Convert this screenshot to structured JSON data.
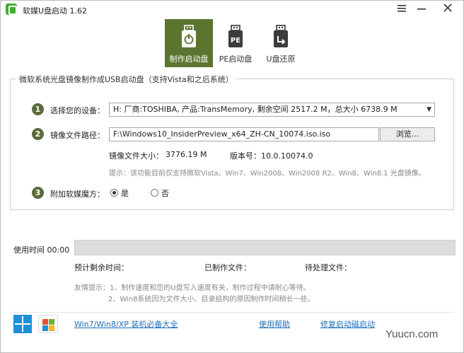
{
  "titlebar": {
    "title": "软媒U盘启动 1.62",
    "menu_icon": "menu-icon",
    "minimize_icon": "minimize-icon",
    "close_icon": "close-icon"
  },
  "tools": [
    {
      "label": "制作启动盘",
      "icon": "usb-power-icon",
      "active": true
    },
    {
      "label": "PE启动盘",
      "icon": "pe-usb-icon",
      "active": false
    },
    {
      "label": "U盘还原",
      "icon": "usb-restore-icon",
      "active": false
    }
  ],
  "group": {
    "title": "微软系统光盘镜像制作成USB启动盘（支持Vista和之后系统）",
    "steps": [
      {
        "number": "1",
        "label": "选择您的设备："
      },
      {
        "number": "2",
        "label": "镜像文件路径："
      },
      {
        "number": "3",
        "label": "附加软媒魔方："
      }
    ],
    "device_value": "H: 厂商:TOSHIBA, 产品:TransMemory,  剩余空间 2517.2 M，总大小 6738.9 M",
    "path_value": "F:\\Windows10_InsiderPreview_x64_ZH-CN_10074.iso.iso",
    "browse_label": "浏览...",
    "image_size_label": "镜像文件大小：",
    "image_size_value": "3776.19 M",
    "version_label": "版本号：10.0.10074.0",
    "hint": "提示：该功能目前仅支持微软Vista、Win7、Win2008、Win2008 R2、Win8、Win8.1 光盘镜像。",
    "radio_yes": "是",
    "radio_no": "否",
    "radio_selected": "yes"
  },
  "progress": {
    "time_label": "使用时间 00:00",
    "percent": 0,
    "remaining_label": "预计剩余时间：",
    "made_label": "已制作文件：",
    "pending_label": "待处理文件：",
    "color": "#6a8a3a"
  },
  "tips": {
    "line1": "友情提示：1、制作速度和您的U盘写入速度有关，制作过程中请耐心等待。",
    "line2": "2、Win8系统因为文件大小、目录结构的原因制作时间稍长一些。"
  },
  "footer": {
    "win8_icon": "windows8-logo-icon",
    "win7_icon": "windows7-logo-icon",
    "link_essentials": "Win7/Win8/XP 装机必备大全",
    "link_help": "使用帮助",
    "link_repair": "修复启动磁启动",
    "watermark": "Yuucn.com"
  },
  "colors": {
    "accent": "#5b7530",
    "step_badge": "#5a6b3a",
    "link": "#1d6fb8"
  }
}
